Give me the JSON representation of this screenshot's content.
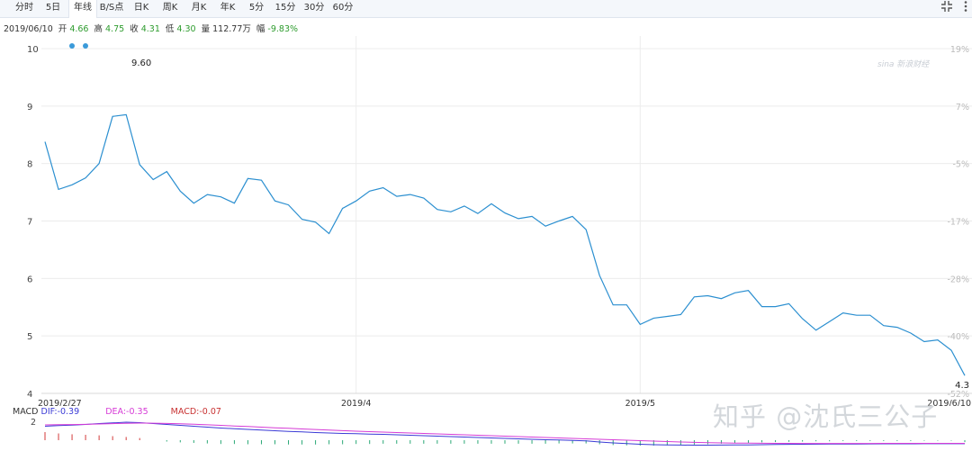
{
  "tabs": [
    {
      "label": "分时",
      "active": false
    },
    {
      "label": "5日",
      "active": false
    },
    {
      "label": "年线",
      "active": true
    },
    {
      "label": "B/S点",
      "active": false
    },
    {
      "label": "日K",
      "active": false
    },
    {
      "label": "周K",
      "active": false
    },
    {
      "label": "月K",
      "active": false
    },
    {
      "label": "年K",
      "active": false
    },
    {
      "label": "5分",
      "active": false
    },
    {
      "label": "15分",
      "active": false
    },
    {
      "label": "30分",
      "active": false
    },
    {
      "label": "60分",
      "active": false
    }
  ],
  "toolbar": {
    "collapse_icon": "collapse-icon",
    "more_icon": "more-vertical-icon"
  },
  "quote": {
    "date": "2019/06/10",
    "open_label": "开",
    "open": "4.66",
    "high_label": "高",
    "high": "4.75",
    "close_label": "收",
    "close": "4.31",
    "low_label": "低",
    "low": "4.30",
    "volume_label": "量",
    "volume": "112.77万",
    "change_label": "幅",
    "change": "-9.83%"
  },
  "watermark": {
    "sina": "sina 新浪财经",
    "zhihu": "知乎 @沈氏三公子"
  },
  "colors": {
    "line": "#2b8fd0",
    "grid": "#ececec",
    "dif": "#3b3bd6",
    "dea": "#d63bd6",
    "macd_up": "#d33a3a",
    "macd_down": "#2aa876",
    "marker": "#3a9ad9"
  },
  "chart_data": {
    "type": "line",
    "y_ticks": [
      4,
      5,
      6,
      7,
      8,
      9,
      10
    ],
    "ylim": [
      4,
      10
    ],
    "right_ticks": [
      "19%",
      "7%",
      "-5%",
      "-17%",
      "-28%",
      "-40%",
      "-52%"
    ],
    "x_tick_labels": [
      "2019/2/27",
      "2019/4",
      "2019/5",
      "2019/6/10"
    ],
    "x_tick_index": [
      0,
      23,
      44,
      68
    ],
    "annotations": {
      "max_label": "9.60",
      "last_label": "4.3"
    },
    "grid": true,
    "series": [
      {
        "values": [
          8.38,
          7.55,
          7.63,
          7.75,
          8.0,
          8.82,
          8.85,
          7.98,
          7.72,
          7.86,
          7.52,
          7.31,
          7.46,
          7.42,
          7.31,
          7.74,
          7.71,
          7.35,
          7.28,
          7.03,
          6.98,
          6.78,
          7.22,
          7.35,
          7.52,
          7.58,
          7.43,
          7.46,
          7.4,
          7.2,
          7.16,
          7.26,
          7.13,
          7.3,
          7.14,
          7.04,
          7.08,
          6.91,
          7.0,
          7.08,
          6.85,
          6.05,
          5.54,
          5.54,
          5.2,
          5.31,
          5.34,
          5.37,
          5.68,
          5.7,
          5.65,
          5.75,
          5.79,
          5.51,
          5.51,
          5.56,
          5.3,
          5.1,
          5.25,
          5.4,
          5.36,
          5.36,
          5.18,
          5.15,
          5.05,
          4.9,
          4.93,
          4.75,
          4.31
        ]
      }
    ],
    "macd": {
      "labels": {
        "name": "MACD",
        "dif_label": "DIF:",
        "dif": "-0.39",
        "dea_label": "DEA:",
        "dea": "-0.35",
        "macd_label": "MACD:",
        "macd": "-0.07"
      },
      "y_tick": "2",
      "dif": [
        1.55,
        1.62,
        1.68,
        1.75,
        1.85,
        1.92,
        2.0,
        1.95,
        1.85,
        1.75,
        1.65,
        1.55,
        1.45,
        1.35,
        1.28,
        1.2,
        1.12,
        1.05,
        0.98,
        0.92,
        0.85,
        0.8,
        0.75,
        0.72,
        0.68,
        0.65,
        0.6,
        0.55,
        0.5,
        0.45,
        0.4,
        0.35,
        0.3,
        0.25,
        0.2,
        0.15,
        0.1,
        0.05,
        0.02,
        -0.02,
        -0.08,
        -0.2,
        -0.3,
        -0.38,
        -0.45,
        -0.5,
        -0.52,
        -0.54,
        -0.55,
        -0.55,
        -0.54,
        -0.53,
        -0.52,
        -0.5,
        -0.48,
        -0.46,
        -0.45,
        -0.44,
        -0.43,
        -0.42,
        -0.42,
        -0.41,
        -0.4,
        -0.4,
        -0.4,
        -0.39,
        -0.39,
        -0.39,
        -0.39
      ],
      "dea": [
        1.7,
        1.72,
        1.74,
        1.76,
        1.8,
        1.84,
        1.88,
        1.9,
        1.89,
        1.86,
        1.82,
        1.77,
        1.71,
        1.65,
        1.58,
        1.52,
        1.45,
        1.38,
        1.32,
        1.25,
        1.19,
        1.12,
        1.06,
        1.0,
        0.95,
        0.9,
        0.85,
        0.8,
        0.75,
        0.7,
        0.65,
        0.6,
        0.55,
        0.5,
        0.45,
        0.4,
        0.35,
        0.3,
        0.25,
        0.2,
        0.15,
        0.1,
        0.05,
        0.0,
        -0.05,
        -0.1,
        -0.15,
        -0.2,
        -0.24,
        -0.27,
        -0.3,
        -0.32,
        -0.33,
        -0.34,
        -0.35,
        -0.35,
        -0.36,
        -0.36,
        -0.36,
        -0.36,
        -0.36,
        -0.36,
        -0.35,
        -0.35,
        -0.35,
        -0.35,
        -0.35,
        -0.35,
        -0.35
      ],
      "hist": [
        0.3,
        0.25,
        0.22,
        0.2,
        0.18,
        0.15,
        0.12,
        0.08,
        0.0,
        -0.05,
        -0.08,
        -0.1,
        -0.12,
        -0.14,
        -0.14,
        -0.15,
        -0.15,
        -0.15,
        -0.16,
        -0.16,
        -0.16,
        -0.15,
        -0.15,
        -0.14,
        -0.14,
        -0.13,
        -0.13,
        -0.13,
        -0.13,
        -0.13,
        -0.13,
        -0.13,
        -0.13,
        -0.13,
        -0.13,
        -0.13,
        -0.13,
        -0.13,
        -0.12,
        -0.12,
        -0.12,
        -0.15,
        -0.18,
        -0.19,
        -0.2,
        -0.2,
        -0.19,
        -0.18,
        -0.16,
        -0.15,
        -0.13,
        -0.11,
        -0.1,
        -0.08,
        -0.07,
        -0.06,
        -0.05,
        -0.04,
        -0.04,
        -0.03,
        -0.03,
        -0.03,
        -0.03,
        -0.03,
        -0.03,
        -0.02,
        -0.02,
        -0.02,
        -0.07
      ]
    }
  }
}
